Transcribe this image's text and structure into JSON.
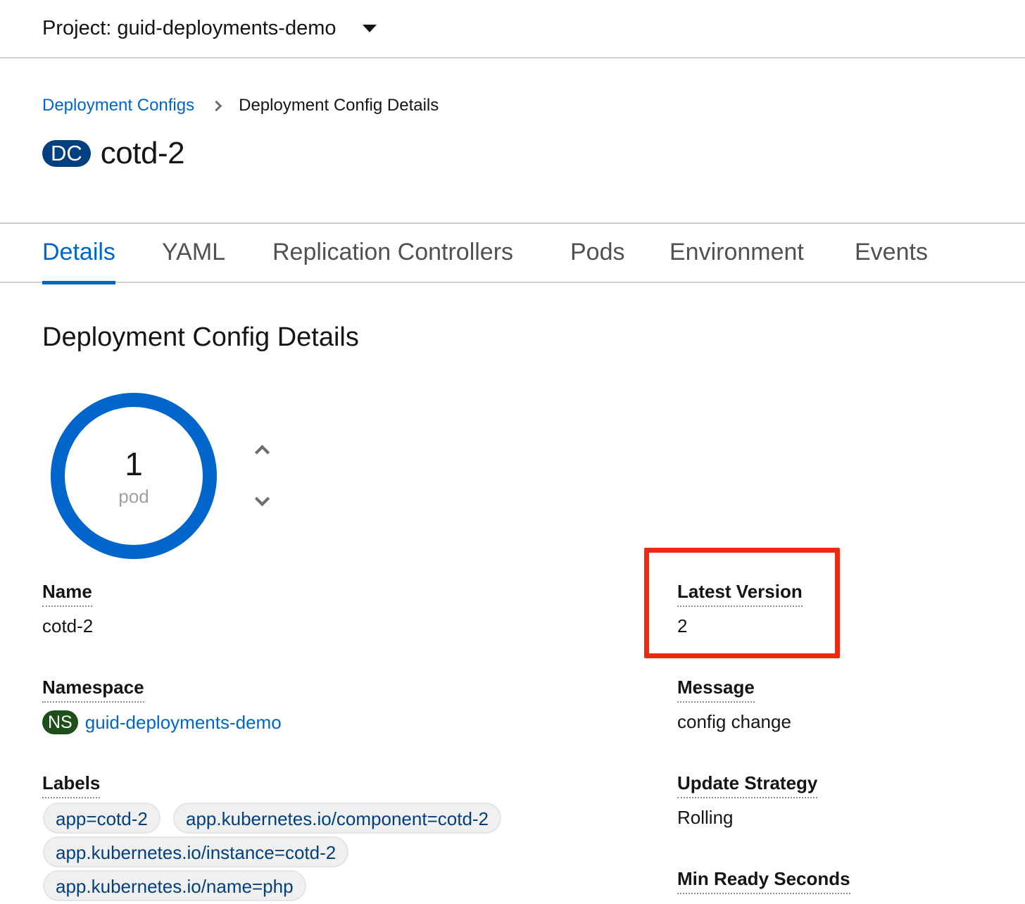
{
  "project": {
    "label": "Project: guid-deployments-demo"
  },
  "breadcrumb": {
    "parent": "Deployment Configs",
    "current": "Deployment Config Details"
  },
  "resource": {
    "badge": "DC",
    "name": "cotd-2"
  },
  "tabs": [
    {
      "label": "Details",
      "active": true
    },
    {
      "label": "YAML"
    },
    {
      "label": "Replication Controllers"
    },
    {
      "label": "Pods"
    },
    {
      "label": "Environment"
    },
    {
      "label": "Events"
    }
  ],
  "section": {
    "title": "Deployment Config Details"
  },
  "pods": {
    "count": "1",
    "label": "pod"
  },
  "details": {
    "name": {
      "label": "Name",
      "value": "cotd-2"
    },
    "namespace": {
      "label": "Namespace",
      "badge": "NS",
      "value": "guid-deployments-demo"
    },
    "labels": {
      "label": "Labels",
      "items": [
        "app=cotd-2",
        "app.kubernetes.io/component=cotd-2",
        "app.kubernetes.io/instance=cotd-2",
        "app.kubernetes.io/name=php"
      ]
    },
    "latest_version": {
      "label": "Latest Version",
      "value": "2"
    },
    "message": {
      "label": "Message",
      "value": "config change"
    },
    "update_strategy": {
      "label": "Update Strategy",
      "value": "Rolling"
    },
    "min_ready_seconds": {
      "label": "Min Ready Seconds"
    }
  },
  "colors": {
    "link": "#0066cc",
    "donut": "#0066cc",
    "highlight": "#ee2a11",
    "badge_dc": "#004080",
    "badge_ns": "#1e4f18"
  }
}
